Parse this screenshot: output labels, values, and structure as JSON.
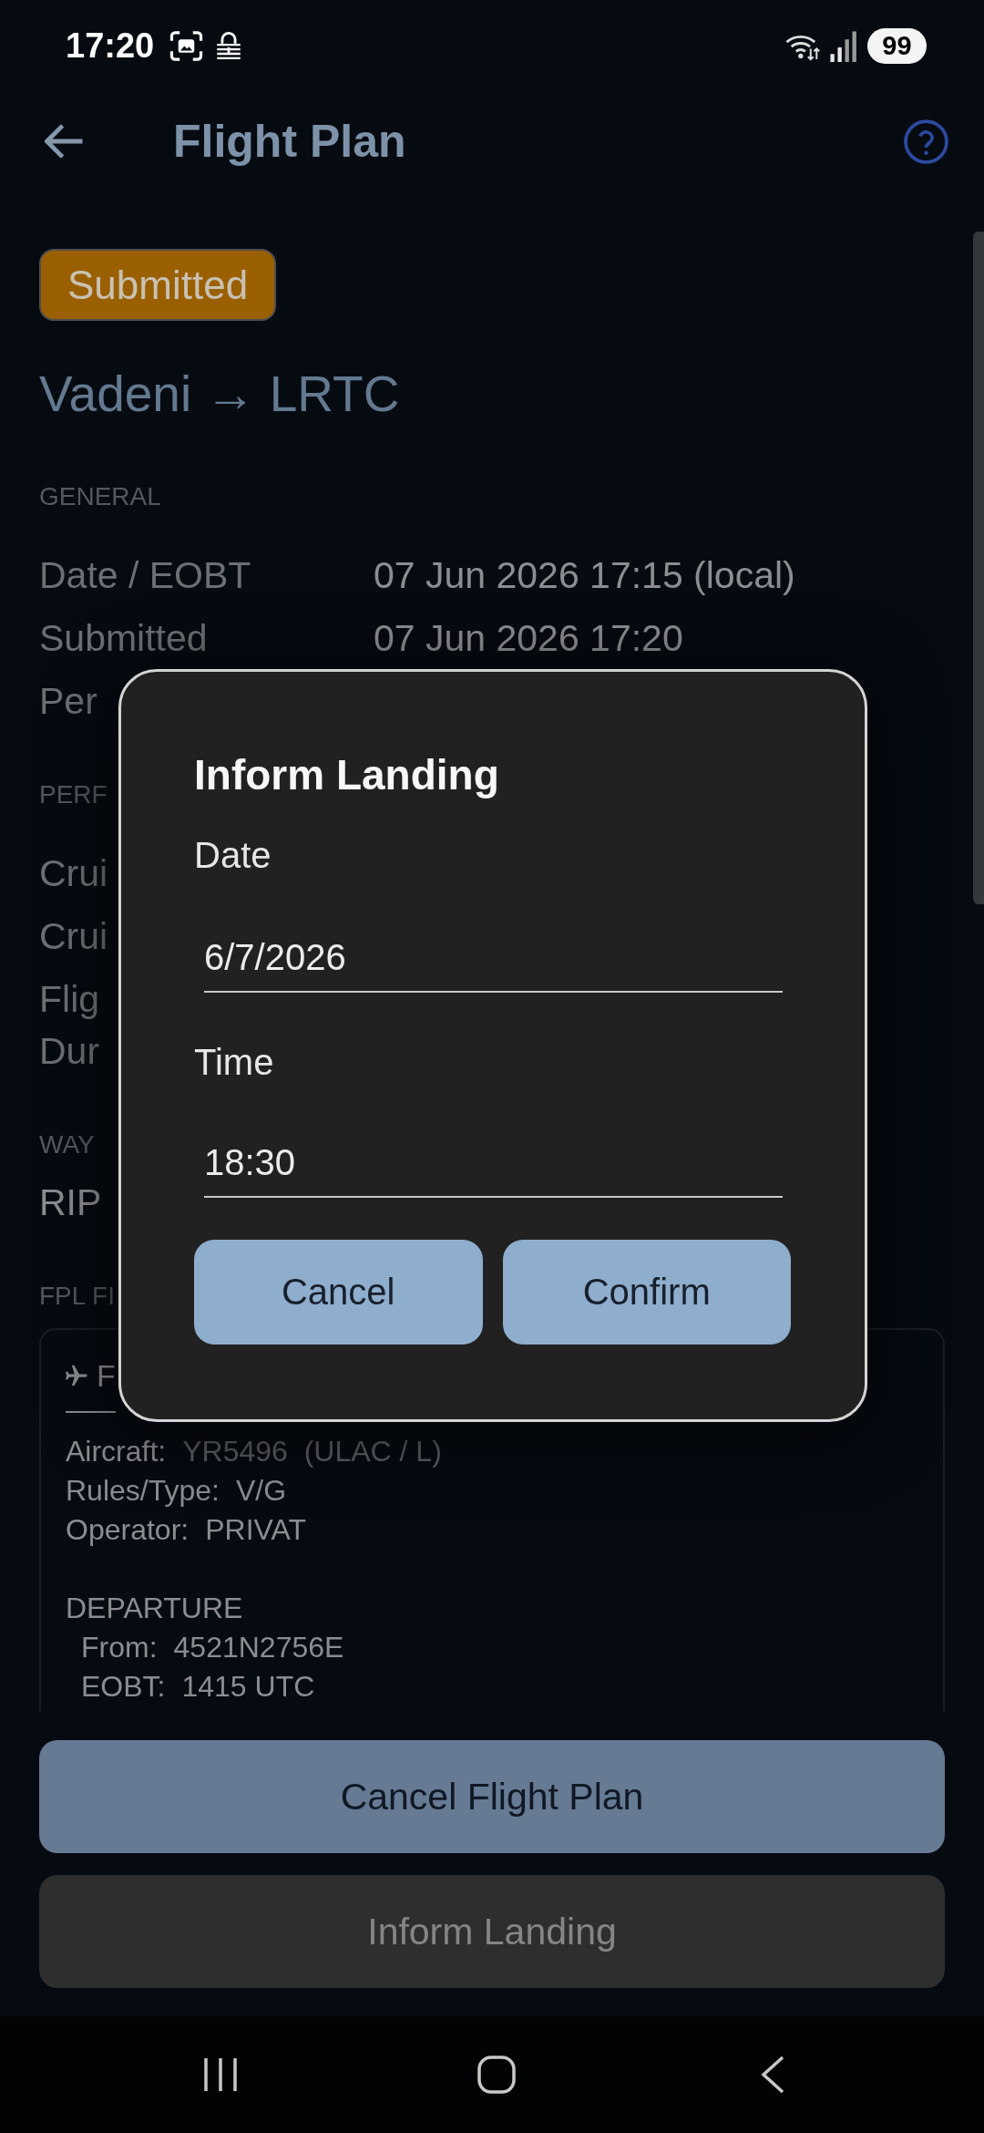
{
  "status_bar": {
    "time": "17:20",
    "battery": "99"
  },
  "app_bar": {
    "title": "Flight Plan"
  },
  "status_badge": "Submitted",
  "route": "Vadeni → LRTC",
  "sections": [
    {
      "kind": "rows",
      "title": "GENERAL",
      "rows": [
        {
          "label": "Date / EOBT",
          "value": "07 Jun 2026 17:15 (local)"
        },
        {
          "label": "Submitted",
          "value": "07 Jun 2026 17:20"
        },
        {
          "label": "Per"
        }
      ]
    },
    {
      "kind": "rows",
      "title": "PERF",
      "rows": [
        {
          "label": "Crui"
        },
        {
          "label": "Crui"
        },
        {
          "label": "Flig\nDur"
        }
      ]
    },
    {
      "kind": "text",
      "title": "WAY",
      "text": "RIP"
    },
    {
      "kind": "card",
      "title": "FPL FI",
      "card": {
        "tab": "F",
        "lines": [
          {
            "label": "Aircraft:",
            "value": "YR5496  (ULAC / L)",
            "muted": true
          },
          {
            "label": "Rules/Type:",
            "value": "V/G",
            "muted": false
          },
          {
            "label": "Operator:",
            "value": "PRIVAT",
            "muted": false
          }
        ],
        "groups": [
          {
            "title": "DEPARTURE",
            "lines": [
              {
                "label": "From:",
                "value": "4521N2756E",
                "muted": false
              },
              {
                "label": "EOBT:",
                "value": "1415 UTC",
                "muted": false
              }
            ]
          }
        ]
      }
    }
  ],
  "dialog": {
    "title": "Inform Landing",
    "fields": [
      {
        "label": "Date",
        "value": "6/7/2026"
      },
      {
        "label": "Time",
        "value": "18:30"
      }
    ],
    "buttons": [
      "Cancel",
      "Confirm"
    ]
  },
  "actions": [
    {
      "label": "Cancel Flight Plan",
      "kind": "primary"
    },
    {
      "label": "Inform Landing",
      "kind": "secondary"
    }
  ]
}
